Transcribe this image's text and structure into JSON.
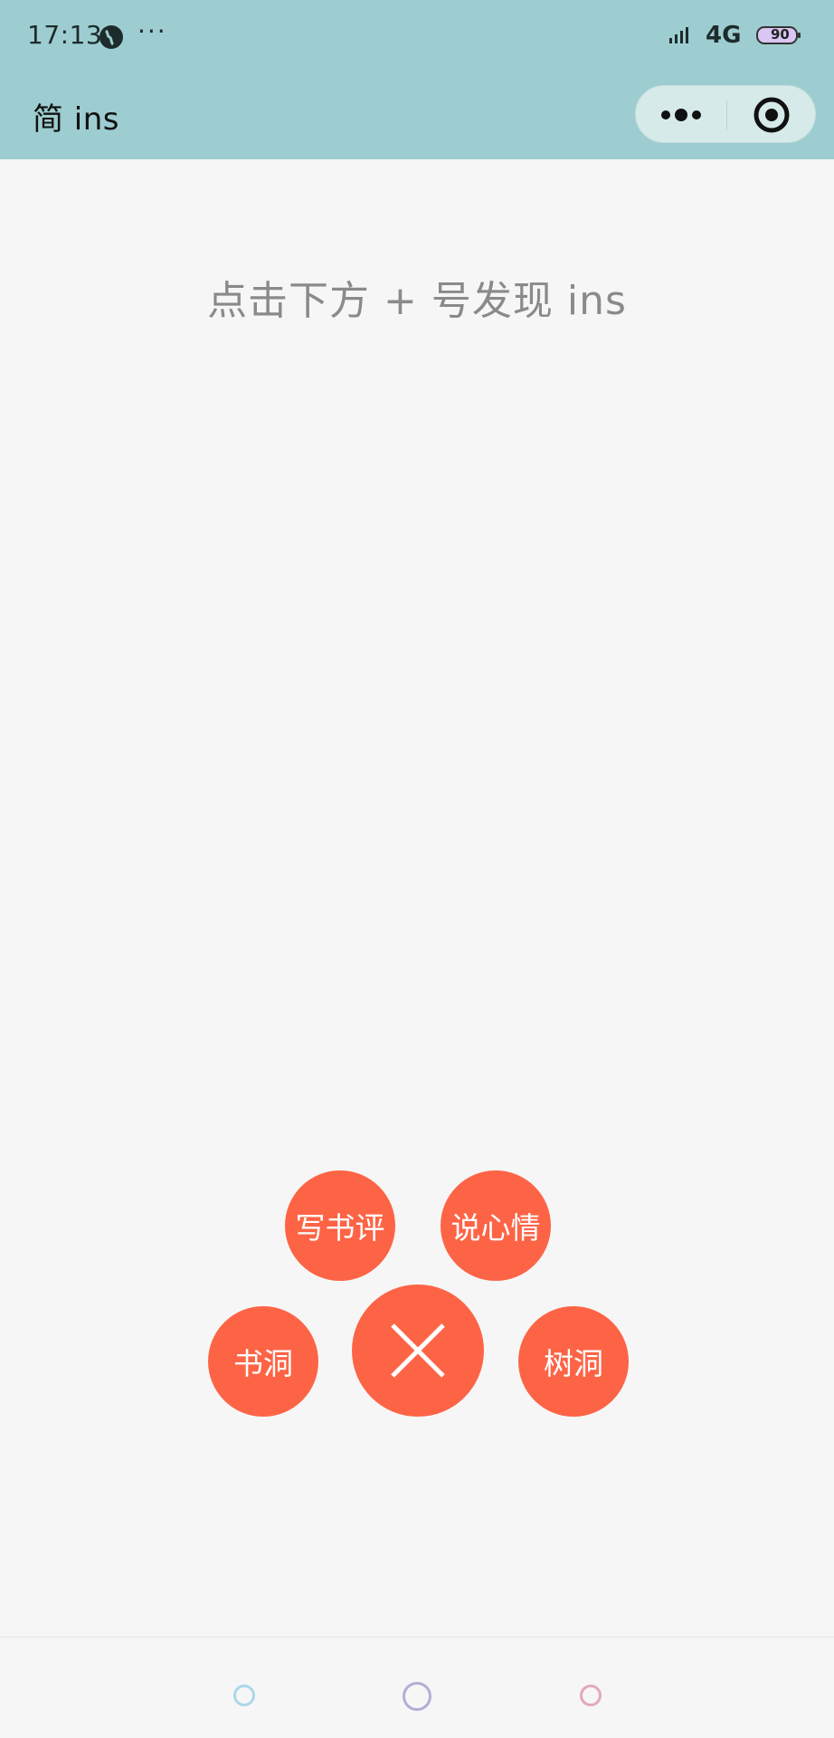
{
  "status_bar": {
    "time": "17:13",
    "more": "···",
    "network": "4G",
    "battery": "90"
  },
  "header": {
    "title": "简 ins",
    "capsule": {
      "more_icon": "more-dots-icon",
      "close_icon": "target-circle-icon"
    }
  },
  "main": {
    "hint_text": "点击下方 + 号发现 ins"
  },
  "fab_menu": {
    "write_review": "写书评",
    "share_mood": "说心情",
    "book_hole": "书洞",
    "tree_hole": "树洞",
    "close_icon": "close-x-icon"
  },
  "tabbar": {
    "tabs": [
      {
        "icon": "circle-icon",
        "color": "#a9d8ec"
      },
      {
        "icon": "circle-icon",
        "color": "#b7acd6"
      },
      {
        "icon": "circle-icon",
        "color": "#e2a9b8"
      }
    ]
  },
  "colors": {
    "header_bg": "#9dcdd0",
    "accent": "#fd6446",
    "page_bg": "#f7f6f6",
    "hint_text": "#8a8a8a"
  }
}
